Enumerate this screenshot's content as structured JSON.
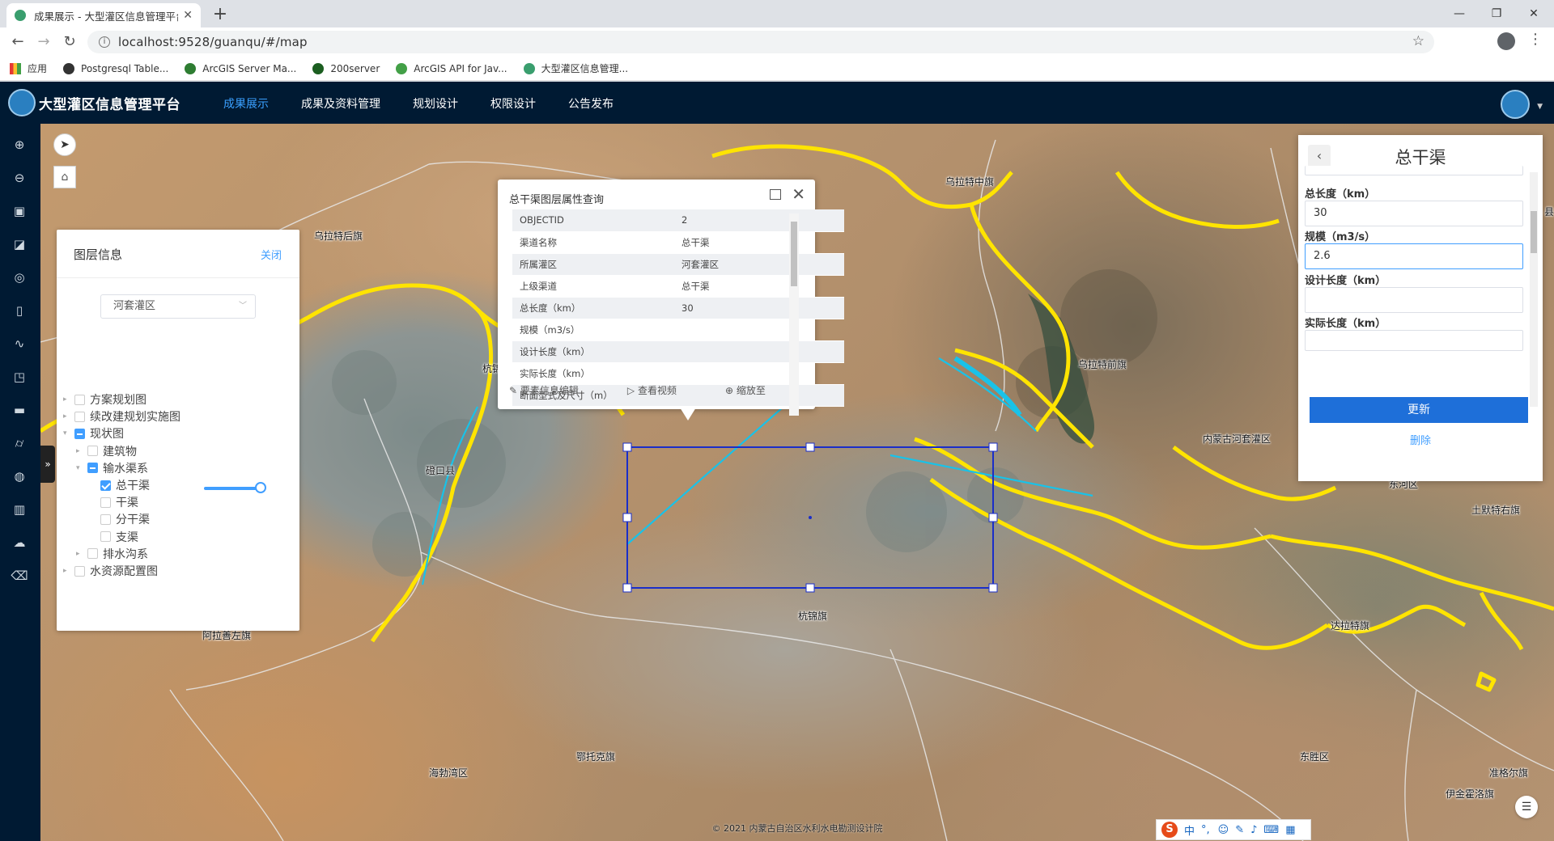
{
  "browser": {
    "tab_title": "成果展示 - 大型灌区信息管理平台",
    "url": "localhost:9528/guanqu/#/map",
    "bookmarks": [
      {
        "label": "应用",
        "color": "#e53935"
      },
      {
        "label": "Postgresql Table...",
        "color": "#333333"
      },
      {
        "label": "ArcGIS Server Ma...",
        "color": "#2e7d32"
      },
      {
        "label": "200server",
        "color": "#1b5e20"
      },
      {
        "label": "ArcGIS API for Jav...",
        "color": "#43a047"
      },
      {
        "label": "大型灌区信息管理...",
        "color": "#3a9e6e"
      }
    ]
  },
  "app": {
    "title": "大型灌区信息管理平台",
    "nav": [
      "成果展示",
      "成果及资料管理",
      "规划设计",
      "权限设计",
      "公告发布"
    ],
    "active_nav": "成果展示",
    "accent": "#3aa0ff",
    "header_bg": "#001a33"
  },
  "toolbar_icons": [
    "zoom-in-icon",
    "zoom-out-icon",
    "layers-icon",
    "measure-icon",
    "globe-icon",
    "location-icon",
    "line-chart-icon",
    "annotation-icon",
    "road-icon",
    "traffic-icon",
    "browser-icon",
    "bar-chart-icon",
    "upload-icon",
    "eraser-icon"
  ],
  "layer_panel": {
    "title": "图层信息",
    "close_label": "关闭",
    "select_value": "河套灌区",
    "tree": [
      {
        "label": "方案规划图",
        "state": "unchecked",
        "caret": "right"
      },
      {
        "label": "续改建规划实施图",
        "state": "unchecked",
        "caret": "right"
      },
      {
        "label": "现状图",
        "state": "indeterminate",
        "caret": "down"
      },
      {
        "label": "建筑物",
        "state": "unchecked",
        "caret": "right"
      },
      {
        "label": "输水渠系",
        "state": "indeterminate",
        "caret": "down"
      },
      {
        "label": "总干渠",
        "state": "checked",
        "caret": ""
      },
      {
        "label": "干渠",
        "state": "unchecked",
        "caret": ""
      },
      {
        "label": "分干渠",
        "state": "unchecked",
        "caret": ""
      },
      {
        "label": "支渠",
        "state": "unchecked",
        "caret": ""
      },
      {
        "label": "排水沟系",
        "state": "unchecked",
        "caret": "right"
      },
      {
        "label": "水资源配置图",
        "state": "unchecked",
        "caret": "right"
      }
    ],
    "opacity": 1.0
  },
  "popup": {
    "title": "总干渠图层属性查询",
    "rows": [
      {
        "k": "OBJECTID",
        "v": "2"
      },
      {
        "k": "渠道名称",
        "v": "总干渠"
      },
      {
        "k": "所属灌区",
        "v": "河套灌区"
      },
      {
        "k": "上级渠道",
        "v": "总干渠"
      },
      {
        "k": "总长度（km）",
        "v": "30"
      },
      {
        "k": "规模（m3/s）",
        "v": ""
      },
      {
        "k": "设计长度（km）",
        "v": ""
      },
      {
        "k": "实际长度（km）",
        "v": ""
      },
      {
        "k": "断面型式及尺寸（m）",
        "v": ""
      }
    ],
    "actions": [
      "要素信息编辑",
      "查看视频",
      "缩放至"
    ]
  },
  "edit_panel": {
    "title": "总干渠",
    "fields": [
      {
        "label": "总长度（km）",
        "value": "30"
      },
      {
        "label": "规模（m3/s）",
        "value": "2.6"
      },
      {
        "label": "设计长度（km）",
        "value": ""
      },
      {
        "label": "实际长度（km）",
        "value": ""
      }
    ],
    "update_label": "更新",
    "delete_label": "删除"
  },
  "map_labels": [
    "乌拉特中旗",
    "乌拉特后旗",
    "杭锦后旗",
    "乌拉特前旗",
    "磴口县",
    "内蒙古河套灌区",
    "杭锦旗",
    "达拉特旗",
    "东河区",
    "土默特右旗",
    "鄂托克旗",
    "东胜区",
    "海勃湾区",
    "阿拉善左旗",
    "准格尔旗",
    "伊金霍洛旗",
    "县"
  ],
  "copyright": "© 2021 内蒙古自治区水利水电勘测设计院",
  "ime": {
    "s": "S",
    "lang": "中",
    "punct": "°,"
  }
}
